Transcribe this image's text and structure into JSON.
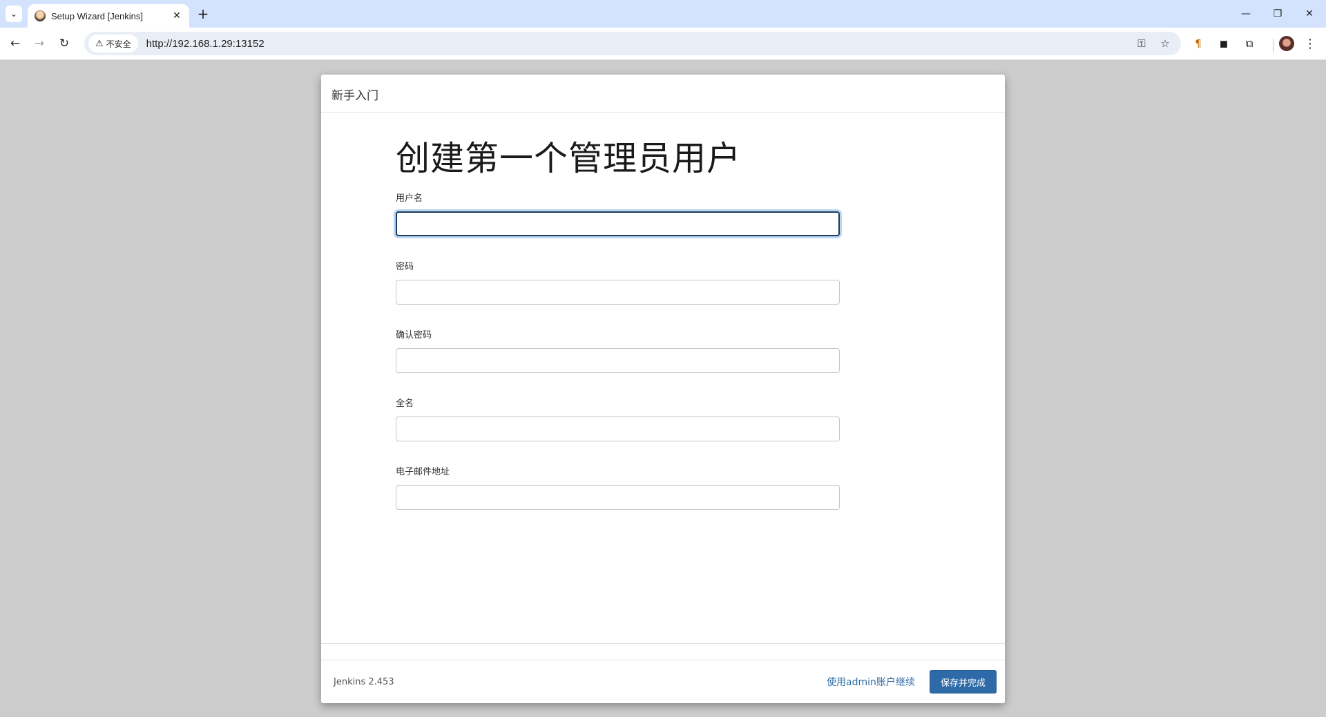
{
  "browser": {
    "tab_title": "Setup Wizard [Jenkins]",
    "security_label": "不安全",
    "url": "http://192.168.1.29:13152"
  },
  "dialog": {
    "header_title": "新手入门",
    "heading": "创建第一个管理员用户",
    "fields": [
      {
        "label": "用户名",
        "value": ""
      },
      {
        "label": "密码",
        "value": ""
      },
      {
        "label": "确认密码",
        "value": ""
      },
      {
        "label": "全名",
        "value": ""
      },
      {
        "label": "电子邮件地址",
        "value": ""
      }
    ],
    "version": "Jenkins 2.453",
    "continue_link": "使用admin账户继续",
    "save_button": "保存并完成"
  },
  "colors": {
    "tabbar_bg": "#d3e3fd",
    "page_bg": "#cccccc",
    "primary_button": "#2f6aa8",
    "link": "#2e6ca4",
    "focus_ring": "#b8d7f0"
  },
  "icons": [
    "tab-list-icon",
    "jenkins-favicon",
    "close-icon",
    "plus-icon",
    "minimize-icon",
    "restore-icon",
    "back-icon",
    "forward-icon",
    "reload-icon",
    "warning-icon",
    "password-key-icon",
    "star-icon",
    "extension-icon",
    "profile-avatar",
    "more-icon"
  ]
}
